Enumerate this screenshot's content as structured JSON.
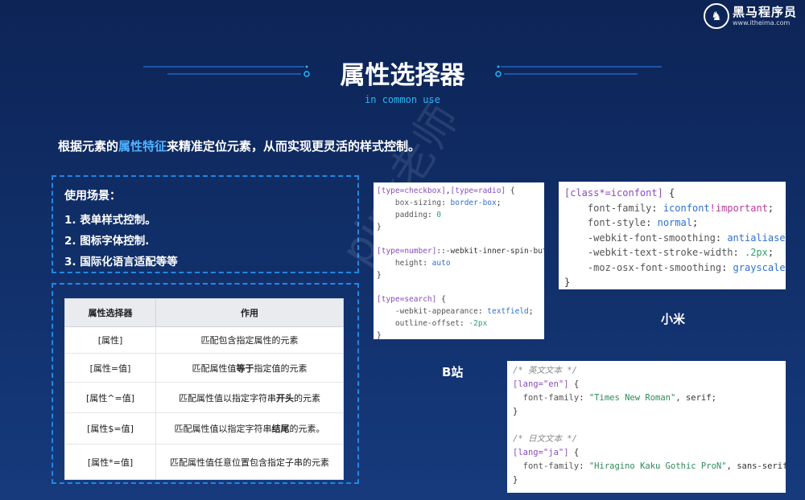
{
  "brand": {
    "name": "黑马程序员",
    "url": "www.itheima.com"
  },
  "title": "属性选择器",
  "subtitle": "in common use",
  "intro": {
    "before": "根据元素的",
    "highlight": "属性特征",
    "after": "来精准定位元素，从而实现更灵活的样式控制。"
  },
  "scenes": {
    "title": "使用场景：",
    "items": [
      "1. 表单样式控制。",
      "2. 图标字体控制.",
      "3. 国际化语言适配等等"
    ]
  },
  "table": {
    "headers": [
      "属性选择器",
      "作用"
    ],
    "rows": [
      {
        "selector": "[属性]",
        "desc_pre": "匹配包含指定属性的元素",
        "desc_bold": "",
        "desc_post": ""
      },
      {
        "selector": "[属性=值]",
        "desc_pre": "匹配属性值",
        "desc_bold": "等于",
        "desc_post": "指定值的元素"
      },
      {
        "selector": "[属性^=值]",
        "desc_pre": "匹配属性值以指定字符串",
        "desc_bold": "开头",
        "desc_post": "的元素"
      },
      {
        "selector": "[属性$=值]",
        "desc_pre": "匹配属性值以指定字符串",
        "desc_bold": "结尾",
        "desc_post": "的元素。"
      },
      {
        "selector": "[属性*=值]",
        "desc_pre": "匹配属性值任意位置包含指定子串的元素",
        "desc_bold": "",
        "desc_post": ""
      }
    ]
  },
  "labels": {
    "bilibili": "B站",
    "xiaomi": "小米"
  },
  "watermark": "pink老师",
  "colors": {
    "accent": "#29b6f6",
    "highlight": "#4fb2ff",
    "dash": "#1e88e5"
  }
}
